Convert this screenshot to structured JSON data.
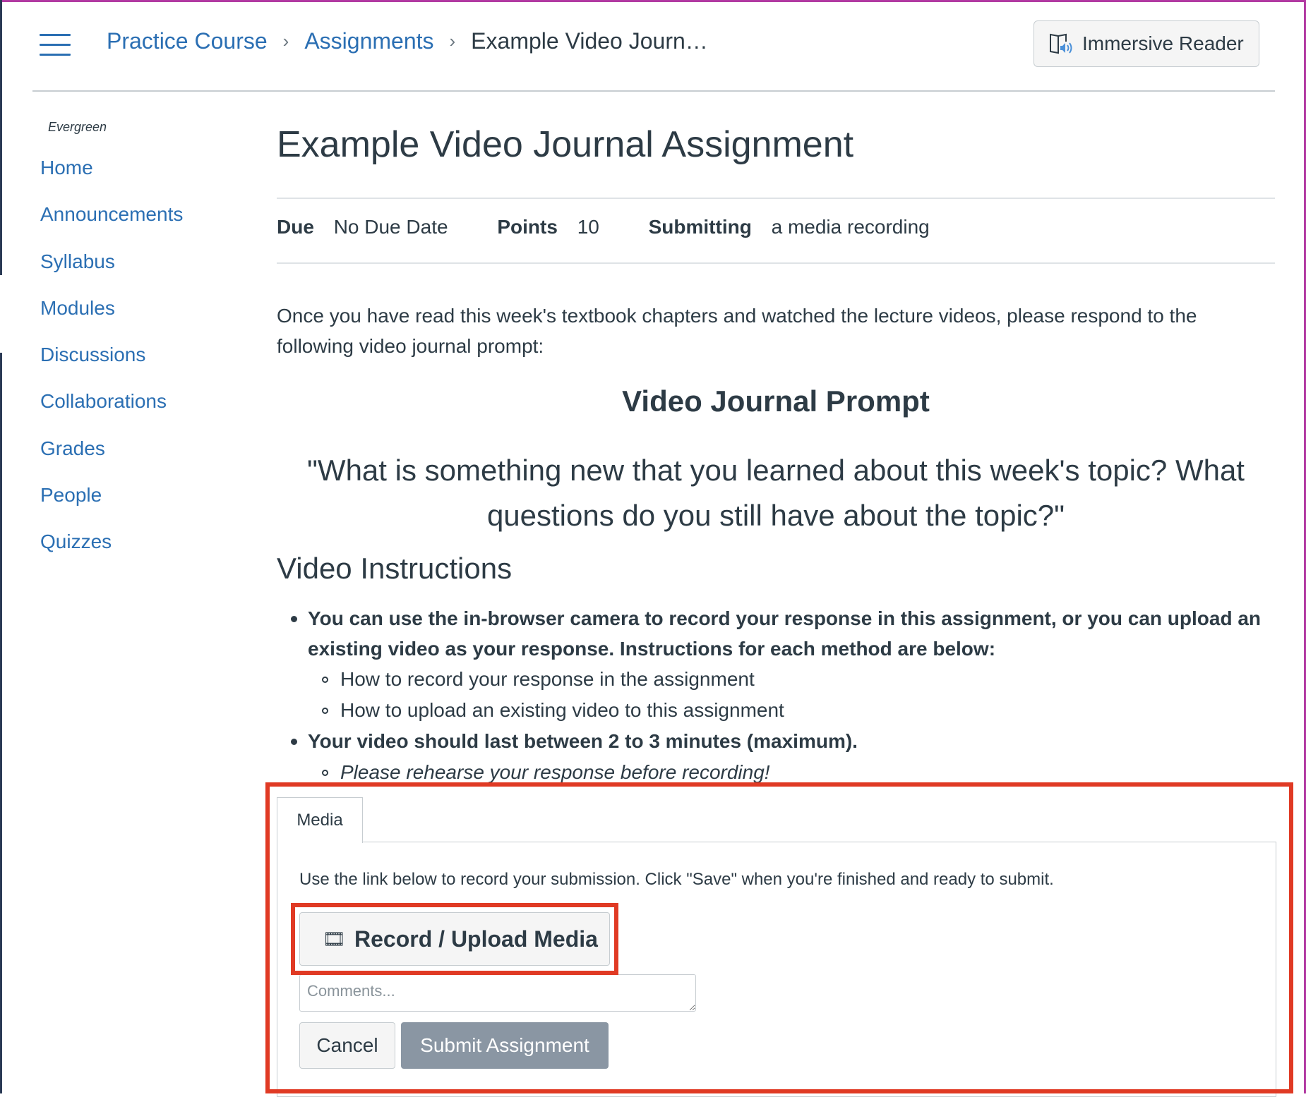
{
  "header": {
    "breadcrumbs": [
      {
        "label": "Practice Course"
      },
      {
        "label": "Assignments"
      },
      {
        "label": "Example Video Journ…"
      }
    ],
    "immersive_reader_label": "Immersive Reader"
  },
  "sidebar": {
    "term": "Evergreen",
    "items": [
      {
        "label": "Home"
      },
      {
        "label": "Announcements"
      },
      {
        "label": "Syllabus"
      },
      {
        "label": "Modules"
      },
      {
        "label": "Discussions"
      },
      {
        "label": "Collaborations"
      },
      {
        "label": "Grades"
      },
      {
        "label": "People"
      },
      {
        "label": "Quizzes"
      }
    ]
  },
  "assignment": {
    "title": "Example Video Journal Assignment",
    "due_label": "Due",
    "due_value": "No Due Date",
    "points_label": "Points",
    "points_value": "10",
    "submitting_label": "Submitting",
    "submitting_value": "a media recording",
    "intro": "Once you have read this week's textbook chapters and watched the lecture videos, please respond to the following video journal prompt:",
    "prompt_heading": "Video Journal Prompt",
    "prompt_question": "\"What is something new that you learned about this week's topic? What questions do you still have about the topic?\"",
    "instructions_heading": "Video Instructions",
    "bullet1": "You can use the in-browser camera to record your response in this assignment, or you can upload an existing video as your response. Instructions for each method are below:",
    "bullet1_sub1": "How to record your response in the assignment",
    "bullet1_sub2": "How to upload an existing video to this assignment",
    "bullet2": "Your video should last between 2 to 3 minutes (maximum).",
    "bullet2_sub1": "Please rehearse your response before recording!"
  },
  "submission": {
    "tab_label": "Media",
    "instruction": "Use the link below to record your submission. Click \"Save\" when you're finished and ready to submit.",
    "record_icon": "🎞",
    "record_label": "Record / Upload Media",
    "comments_placeholder": "Comments...",
    "cancel_label": "Cancel",
    "submit_label": "Submit Assignment"
  },
  "colors": {
    "link": "#2b6fb3",
    "highlight": "#e03a24",
    "submit_disabled": "#8a96a3"
  }
}
